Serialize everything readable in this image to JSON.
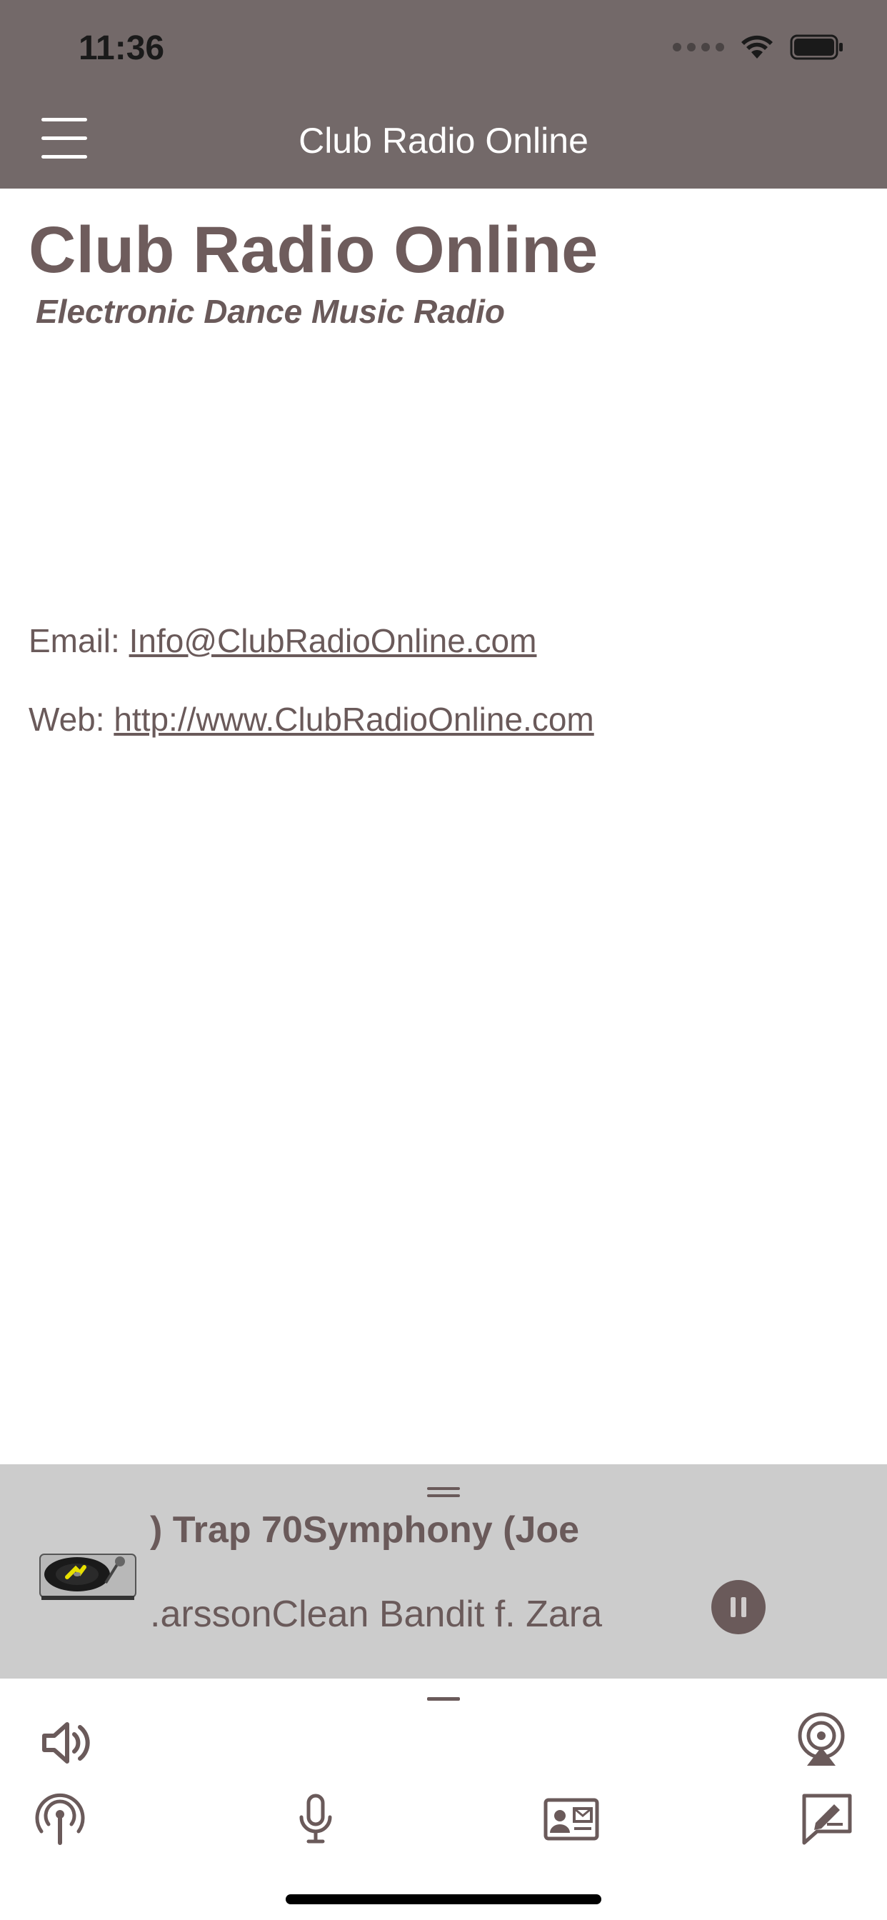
{
  "status_bar": {
    "time": "11:36"
  },
  "nav_bar": {
    "title": "Club Radio Online"
  },
  "content": {
    "title": "Club Radio Online",
    "subtitle": "Electronic Dance Music Radio",
    "email_label": "Email:",
    "email_link": "Info@ClubRadioOnline.com",
    "web_label": "Web:",
    "web_link": "http://www.ClubRadioOnline.com"
  },
  "player": {
    "track_title": ") Trap 70Symphony (Joe",
    "track_artist": ".arssonClean Bandit f. Zara"
  },
  "icons": {
    "menu": "hamburger-menu-icon",
    "volume": "speaker-icon",
    "airplay": "airplay-icon",
    "podcast": "broadcast-icon",
    "mic": "microphone-icon",
    "contact": "contact-card-icon",
    "message": "compose-message-icon"
  },
  "colors": {
    "header": "#736969",
    "text": "#6a5a5a",
    "player_bg": "#cccccc"
  }
}
